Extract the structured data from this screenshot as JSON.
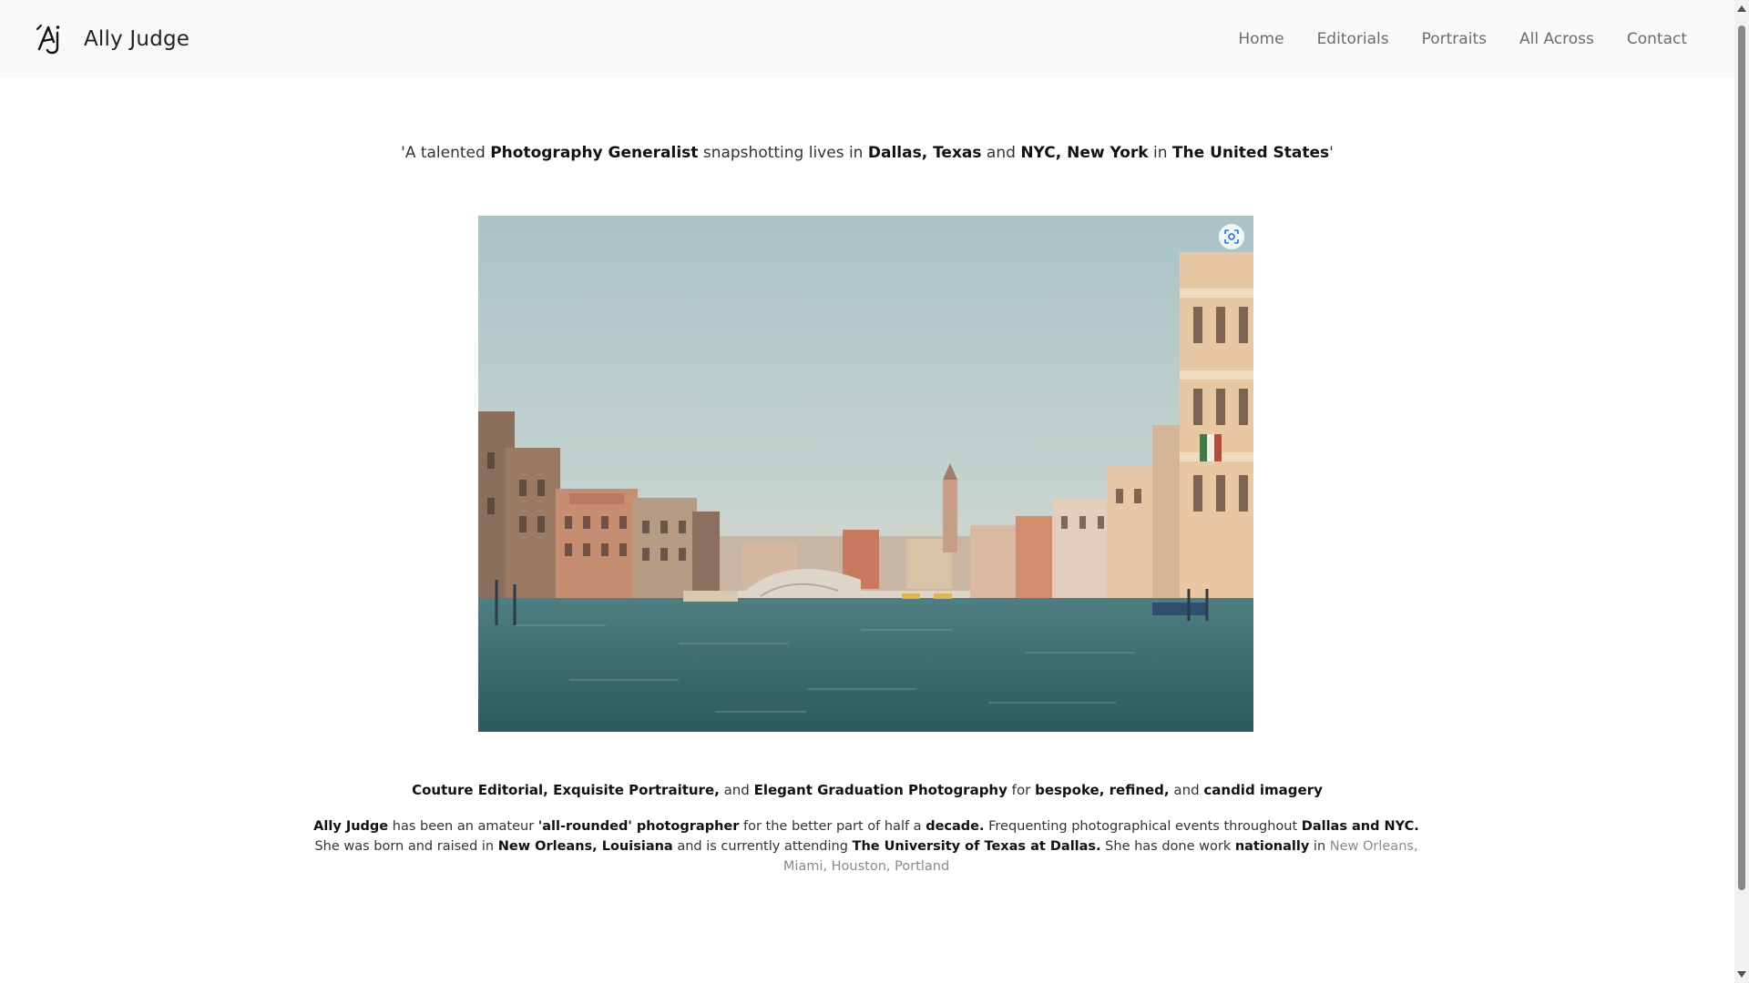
{
  "navbar": {
    "brand_name": "Ally Judge",
    "logo_icon": "aj-monogram-icon",
    "links": [
      "Home",
      "Editorials",
      "Portraits",
      "All Across",
      "Contact"
    ]
  },
  "tagline": {
    "open_quote": "'A talented ",
    "role": "Photography Generalist",
    "t1": " snapshotting lives in ",
    "city1": "Dallas, Texas",
    "t2": " and ",
    "city2": "NYC, New York",
    "t3": " in ",
    "country": "The United States",
    "close_quote": "'"
  },
  "hero_image": {
    "subject": "Venice Grand Canal with Rialto Bridge",
    "lens_icon": "visual-search-icon"
  },
  "services": {
    "s1": "Couture Editorial, Exquisite Portraiture,",
    "t1": " and ",
    "s2": "Elegant Graduation Photography",
    "t2": " for ",
    "q1": "bespoke, refined,",
    "t3": " and ",
    "q2": "candid imagery"
  },
  "bio": {
    "name": "Ally Judge",
    "t1": " has been an amateur ",
    "style": "'all-rounded' photographer",
    "t2": " for the better part of half a ",
    "period": "decade.",
    "t3": " Frequenting photographical events throughout ",
    "places": "Dallas and NYC.",
    "t4": " She was born and raised in ",
    "hometown": "New Orleans, Louisiana",
    "t5": " and is currently attending ",
    "school": "The University of Texas at Dallas.",
    "t6": " She has done work ",
    "scope": "nationally",
    "t7": " in ",
    "cities": "New Orleans, Miami, Houston, Portland"
  },
  "colors": {
    "navbar_bg": "#f8f9fa",
    "text": "#333333",
    "muted": "#8a8a8a"
  }
}
